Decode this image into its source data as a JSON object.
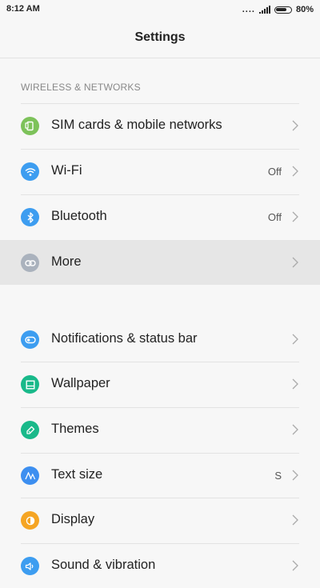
{
  "status_bar": {
    "time": "8:12 AM",
    "dots": "....",
    "battery_percent": "80%",
    "battery_level": 0.8
  },
  "header": {
    "title": "Settings"
  },
  "section": {
    "title": "WIRELESS & NETWORKS"
  },
  "items": [
    {
      "label": "SIM cards & mobile networks",
      "value": "",
      "icon": "sim-card-icon",
      "color": "#7dc25a"
    },
    {
      "label": "Wi-Fi",
      "value": "Off",
      "icon": "wifi-icon",
      "color": "#3d9df0"
    },
    {
      "label": "Bluetooth",
      "value": "Off",
      "icon": "bluetooth-icon",
      "color": "#3d9df0"
    },
    {
      "label": "More",
      "value": "",
      "icon": "link-icon",
      "color": "#aab2bd"
    },
    {
      "label": "Notifications & status bar",
      "value": "",
      "icon": "toggle-icon",
      "color": "#3d9df0"
    },
    {
      "label": "Wallpaper",
      "value": "",
      "icon": "wallpaper-icon",
      "color": "#19b98a"
    },
    {
      "label": "Themes",
      "value": "",
      "icon": "brush-icon",
      "color": "#19b98a"
    },
    {
      "label": "Text size",
      "value": "S",
      "icon": "text-size-icon",
      "color": "#3d8ff0"
    },
    {
      "label": "Display",
      "value": "",
      "icon": "display-icon",
      "color": "#f5a524"
    },
    {
      "label": "Sound & vibration",
      "value": "",
      "icon": "speaker-icon",
      "color": "#3d9df0"
    }
  ]
}
